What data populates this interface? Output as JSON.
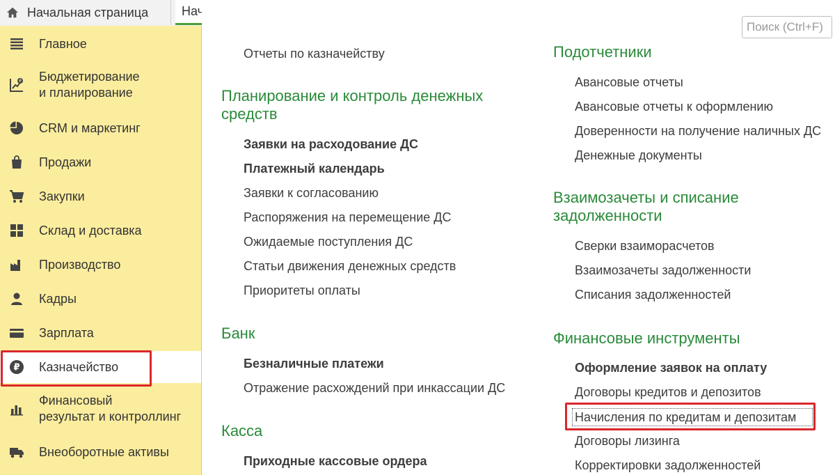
{
  "tabs": {
    "home_label": "Начальная страница",
    "current_label": "Нач"
  },
  "search": {
    "placeholder": "Поиск (Ctrl+F)"
  },
  "sidebar": {
    "items": [
      {
        "label": "Главное",
        "icon": "menu-lines-icon"
      },
      {
        "label": "Бюджетирование\nи планирование",
        "icon": "budget-chart-icon"
      },
      {
        "label": "CRM и маркетинг",
        "icon": "pie-chart-icon"
      },
      {
        "label": "Продажи",
        "icon": "shopping-bag-icon"
      },
      {
        "label": "Закупки",
        "icon": "shopping-cart-icon"
      },
      {
        "label": "Склад и доставка",
        "icon": "warehouse-grid-icon"
      },
      {
        "label": "Производство",
        "icon": "factory-icon"
      },
      {
        "label": "Кадры",
        "icon": "person-icon"
      },
      {
        "label": "Зарплата",
        "icon": "wallet-card-icon"
      },
      {
        "label": "Казначейство",
        "icon": "ruble-coin-icon",
        "active": true
      },
      {
        "label": "Финансовый\nрезультат и контроллинг",
        "icon": "bar-chart-icon"
      },
      {
        "label": "Внеоборотные активы",
        "icon": "truck-icon"
      }
    ]
  },
  "col1": {
    "top_link": "Отчеты по казначейству",
    "planning": {
      "title": "Планирование и контроль денежных средств",
      "items": [
        "Заявки на расходование ДС",
        "Платежный календарь",
        "Заявки к согласованию",
        "Распоряжения на перемещение ДС",
        "Ожидаемые поступления ДС",
        "Статьи движения денежных средств",
        "Приоритеты оплаты"
      ]
    },
    "bank": {
      "title": "Банк",
      "items": [
        "Безналичные платежи",
        "Отражение расхождений при инкассации ДС"
      ]
    },
    "cash": {
      "title": "Касса",
      "items": [
        "Приходные кассовые ордера"
      ]
    }
  },
  "col2": {
    "accountable": {
      "title": "Подотчетники",
      "items": [
        "Авансовые отчеты",
        "Авансовые отчеты к оформлению",
        "Доверенности на получение наличных ДС",
        "Денежные документы"
      ]
    },
    "offsets": {
      "title": "Взаимозачеты и списание задолженности",
      "items": [
        "Сверки взаиморасчетов",
        "Взаимозачеты задолженности",
        "Списания задолженностей"
      ]
    },
    "instruments": {
      "title": "Финансовые инструменты",
      "items": [
        "Оформление заявок на оплату",
        "Договоры кредитов и депозитов",
        "Начисления по кредитам и депозитам",
        "Договоры лизинга",
        "Корректировки задолженностей"
      ]
    }
  },
  "colors": {
    "sidebar_bg": "#fbed9e",
    "heading": "#2a8a3a",
    "highlight": "#d9262a"
  }
}
